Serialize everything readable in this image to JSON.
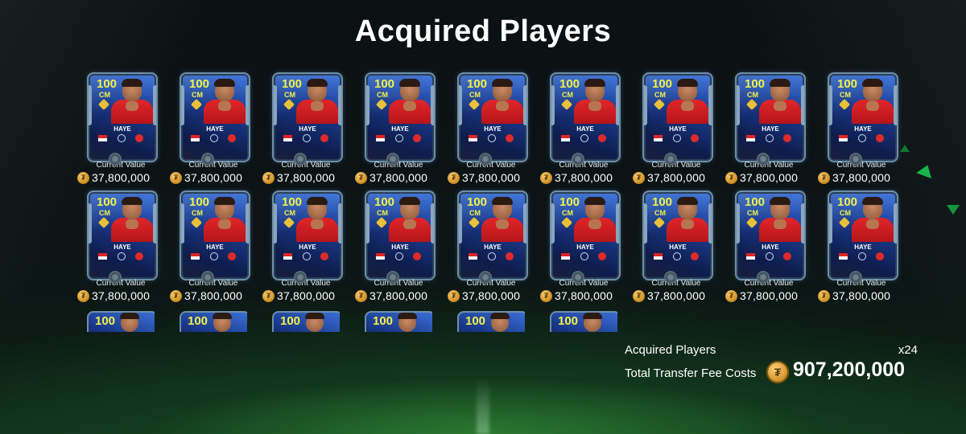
{
  "screen": {
    "title": "Acquired Players"
  },
  "players": [
    {
      "rating": "100",
      "position": "CM",
      "name": "HAYE",
      "value_label": "Current Value",
      "value": "37,800,000"
    },
    {
      "rating": "100",
      "position": "CM",
      "name": "HAYE",
      "value_label": "Current Value",
      "value": "37,800,000"
    },
    {
      "rating": "100",
      "position": "CM",
      "name": "HAYE",
      "value_label": "Current Value",
      "value": "37,800,000"
    },
    {
      "rating": "100",
      "position": "CM",
      "name": "HAYE",
      "value_label": "Current Value",
      "value": "37,800,000"
    },
    {
      "rating": "100",
      "position": "CM",
      "name": "HAYE",
      "value_label": "Current Value",
      "value": "37,800,000"
    },
    {
      "rating": "100",
      "position": "CM",
      "name": "HAYE",
      "value_label": "Current Value",
      "value": "37,800,000"
    },
    {
      "rating": "100",
      "position": "CM",
      "name": "HAYE",
      "value_label": "Current Value",
      "value": "37,800,000"
    },
    {
      "rating": "100",
      "position": "CM",
      "name": "HAYE",
      "value_label": "Current Value",
      "value": "37,800,000"
    },
    {
      "rating": "100",
      "position": "CM",
      "name": "HAYE",
      "value_label": "Current Value",
      "value": "37,800,000"
    },
    {
      "rating": "100",
      "position": "CM",
      "name": "HAYE",
      "value_label": "Current Value",
      "value": "37,800,000"
    },
    {
      "rating": "100",
      "position": "CM",
      "name": "HAYE",
      "value_label": "Current Value",
      "value": "37,800,000"
    },
    {
      "rating": "100",
      "position": "CM",
      "name": "HAYE",
      "value_label": "Current Value",
      "value": "37,800,000"
    },
    {
      "rating": "100",
      "position": "CM",
      "name": "HAYE",
      "value_label": "Current Value",
      "value": "37,800,000"
    },
    {
      "rating": "100",
      "position": "CM",
      "name": "HAYE",
      "value_label": "Current Value",
      "value": "37,800,000"
    },
    {
      "rating": "100",
      "position": "CM",
      "name": "HAYE",
      "value_label": "Current Value",
      "value": "37,800,000"
    },
    {
      "rating": "100",
      "position": "CM",
      "name": "HAYE",
      "value_label": "Current Value",
      "value": "37,800,000"
    },
    {
      "rating": "100",
      "position": "CM",
      "name": "HAYE",
      "value_label": "Current Value",
      "value": "37,800,000"
    },
    {
      "rating": "100",
      "position": "CM",
      "name": "HAYE",
      "value_label": "Current Value",
      "value": "37,800,000"
    }
  ],
  "partial_cards": [
    {
      "rating": "100"
    },
    {
      "rating": "100"
    },
    {
      "rating": "100"
    },
    {
      "rating": "100"
    },
    {
      "rating": "100"
    },
    {
      "rating": "100"
    }
  ],
  "summary": {
    "acquired_label": "Acquired Players",
    "acquired_count": "x24",
    "fee_label": "Total Transfer Fee Costs",
    "fee_total": "907,200,000"
  },
  "icons": {
    "coin": "coin-icon",
    "flag": "flag-icon",
    "league": "league-icon",
    "club": "club-badge-icon"
  },
  "colors": {
    "rating_text": "#f2f24a",
    "card_blue": "#1b3a8c",
    "coin_gold": "#d79a2a",
    "background": "#0d1416"
  }
}
